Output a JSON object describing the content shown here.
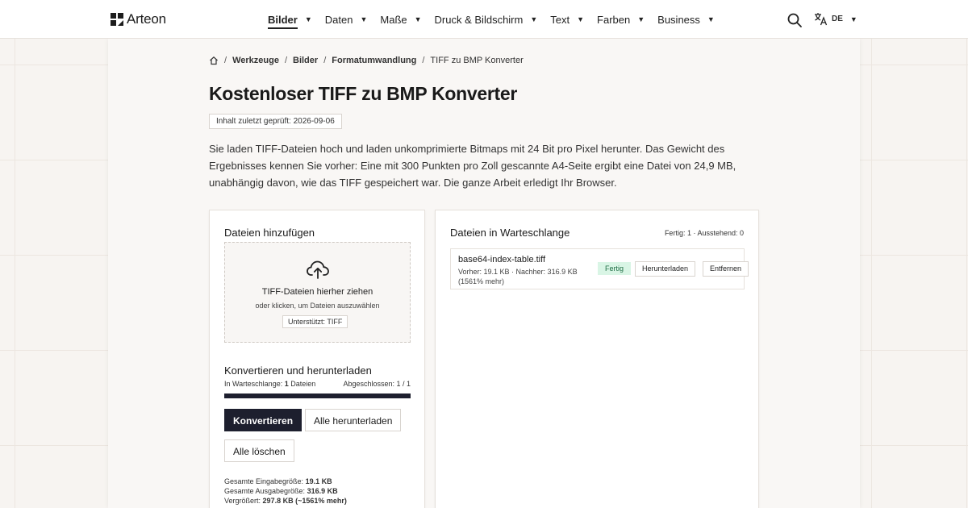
{
  "brand": {
    "name": "Arteon"
  },
  "nav": {
    "items": [
      {
        "label": "Bilder",
        "active": true
      },
      {
        "label": "Daten",
        "active": false
      },
      {
        "label": "Maße",
        "active": false
      },
      {
        "label": "Druck & Bildschirm",
        "active": false
      },
      {
        "label": "Text",
        "active": false
      },
      {
        "label": "Farben",
        "active": false
      },
      {
        "label": "Business",
        "active": false
      }
    ],
    "caret": "▼",
    "language": "DE",
    "icons": {
      "search": "search-icon",
      "language": "translate-icon",
      "home": "home-icon"
    }
  },
  "breadcrumb": {
    "items": [
      "Werkzeuge",
      "Bilder",
      "Formatumwandlung"
    ],
    "current": "TIFF zu BMP Konverter",
    "separator": "/"
  },
  "page": {
    "title": "Kostenloser TIFF zu BMP Konverter",
    "reviewed": "Inhalt zuletzt geprüft: 2026-09-06",
    "intro": "Sie laden TIFF-Dateien hoch und laden unkomprimierte Bitmaps mit 24 Bit pro Pixel herunter. Das Gewicht des Ergebnisses kennen Sie vorher: Eine mit 300 Punkten pro Zoll gescannte A4-Seite ergibt eine Datei von 24,9 MB, unabhängig davon, wie das TIFF gespeichert war. Die ganze Arbeit erledigt Ihr Browser."
  },
  "upload": {
    "title": "Dateien hinzufügen",
    "drop_title": "TIFF-Dateien hierher ziehen",
    "drop_sub": "oder klicken, um Dateien auszuwählen",
    "supported": "Unterstützt: TIFF"
  },
  "convert": {
    "title": "Konvertieren und herunterladen",
    "queue_label": "In Warteschlange:",
    "queue_count": "1",
    "queue_unit": "Dateien",
    "completed": "Abgeschlossen: 1 / 1",
    "progress": 1.0,
    "convert_button": "Konvertieren",
    "download_all_button": "Alle herunterladen",
    "clear_button": "Alle löschen",
    "totals": {
      "input_label": "Gesamte Eingabegröße:",
      "input_value": "19.1 KB",
      "output_label": "Gesamte Ausgabegröße:",
      "output_value": "316.9 KB",
      "growth_label": "Vergrößert:",
      "growth_value": "297.8 KB (~1561% mehr)"
    }
  },
  "queue": {
    "title": "Dateien in Warteschlange",
    "status": "Fertig: 1 · Ausstehend: 0",
    "files": [
      {
        "name": "base64-index-table.tiff",
        "meta": "Vorher: 19.1 KB · Nachher: 316.9 KB (1561% mehr)",
        "status": "Fertig",
        "download_label": "Herunterladen",
        "remove_label": "Entfernen"
      }
    ]
  }
}
